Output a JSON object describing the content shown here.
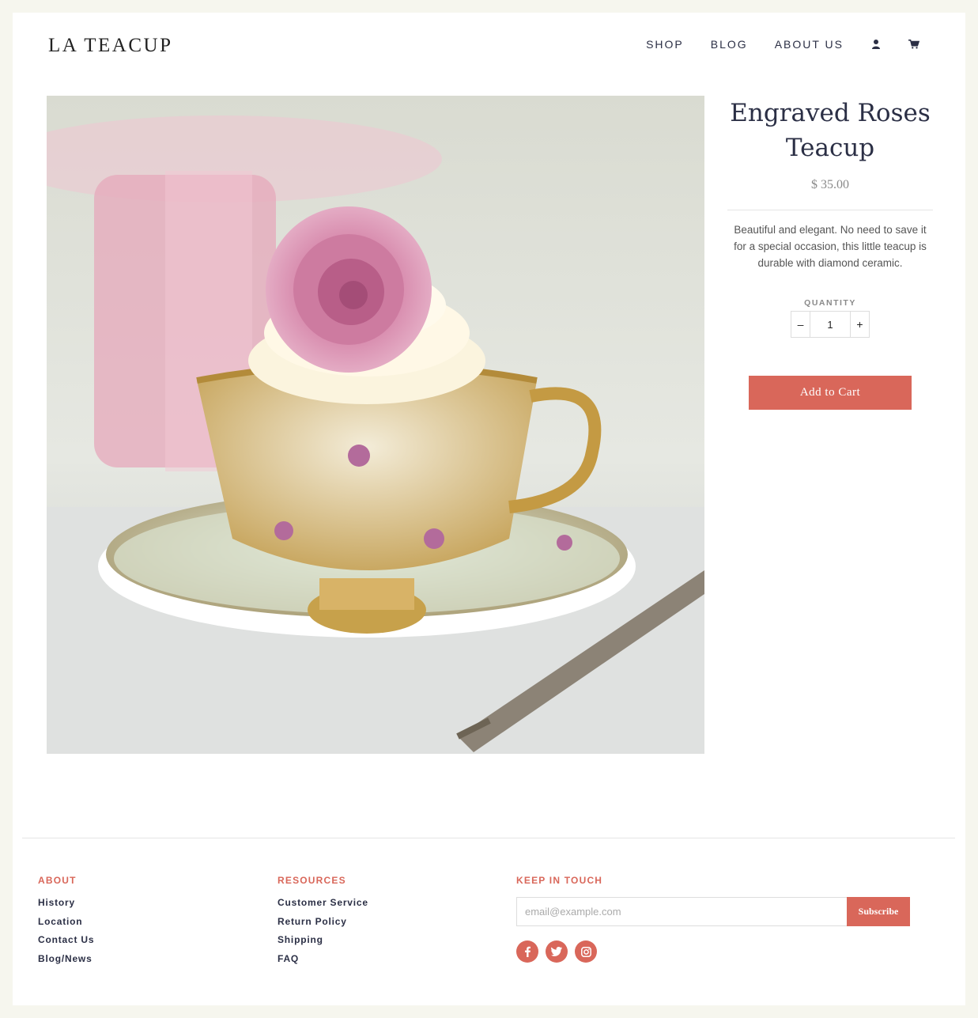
{
  "header": {
    "logo": "LA TEACUP",
    "nav": [
      "SHOP",
      "BLOG",
      "ABOUT US"
    ],
    "icons": [
      "user-icon",
      "cart-icon"
    ]
  },
  "product": {
    "image_icon": "teacup-photo",
    "title": "Engraved Roses Teacup",
    "price": "$ 35.00",
    "description": "Beautiful and elegant. No need to save it for a special occasion, this little teacup is durable with diamond ceramic.",
    "quantity_label": "QUANTITY",
    "quantity_value": "1",
    "minus_label": "–",
    "plus_label": "+",
    "add_to_cart": "Add to Cart"
  },
  "footer": {
    "about": {
      "heading": "ABOUT",
      "links": [
        "History",
        "Location",
        "Contact Us",
        "Blog/News"
      ]
    },
    "resources": {
      "heading": "RESOURCES",
      "links": [
        "Customer Service",
        "Return Policy",
        "Shipping",
        "FAQ"
      ]
    },
    "keep_in_touch": {
      "heading": "KEEP IN TOUCH",
      "email_placeholder": "email@example.com",
      "subscribe": "Subscribe",
      "social_icons": [
        "facebook-icon",
        "twitter-icon",
        "instagram-icon"
      ]
    }
  },
  "colors": {
    "accent": "#d9675a",
    "text": "#2b2f45",
    "page_bg": "#f6f6ee"
  }
}
